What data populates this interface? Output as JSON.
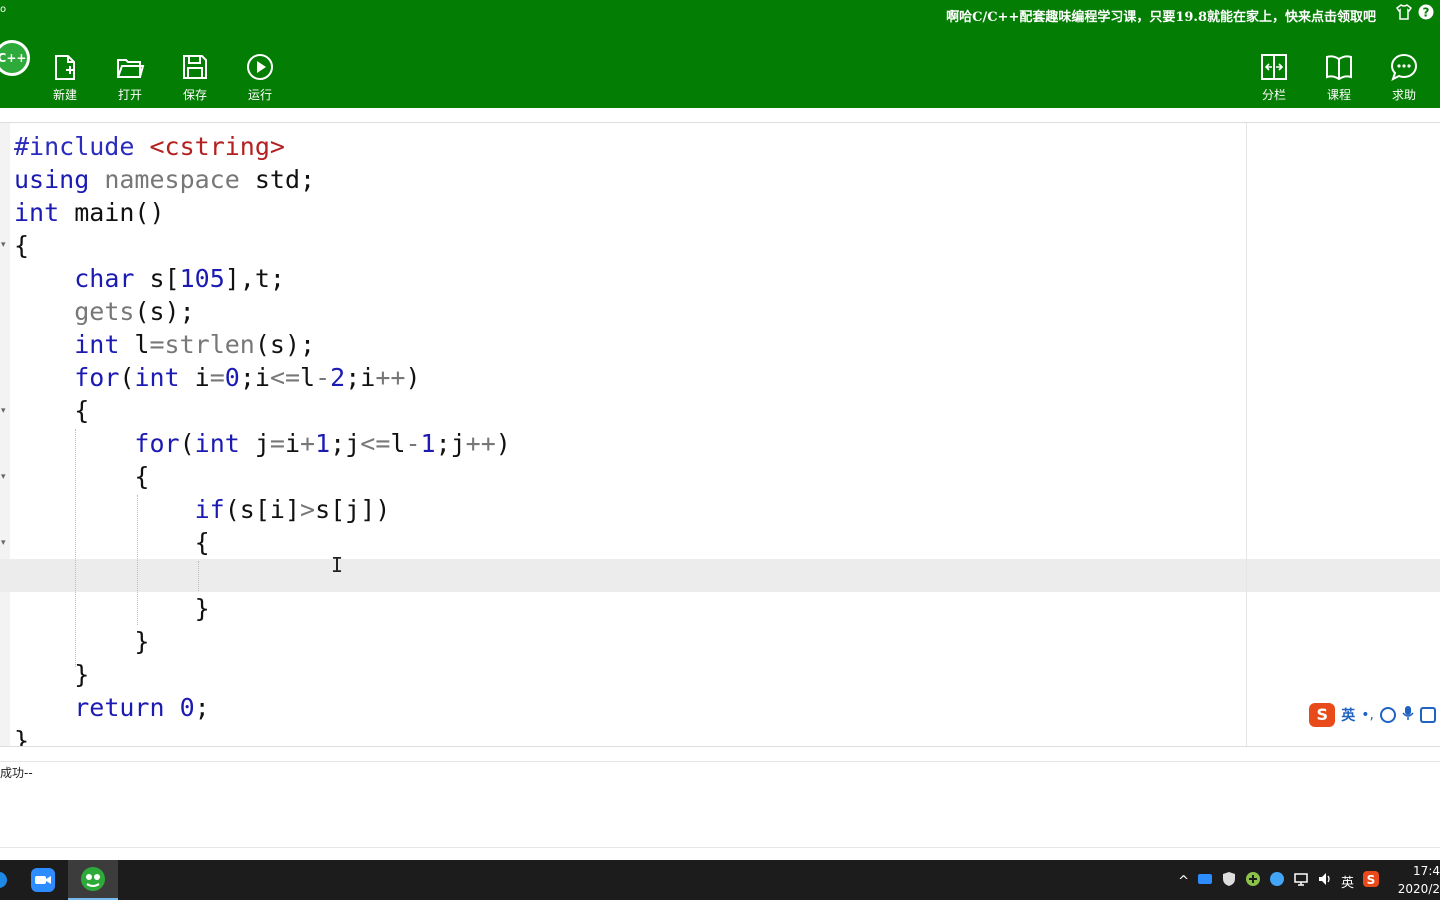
{
  "window": {
    "title_fragment": "o",
    "promo_text": "啊哈C/C++配套趣味编程学习课，只要19.8就能在家上，快来点击领取吧"
  },
  "logo_text": "C++",
  "toolbar": {
    "new_label": "新建",
    "open_label": "打开",
    "save_label": "保存",
    "run_label": "运行",
    "split_label": "分栏",
    "course_label": "课程",
    "help_label": "求助"
  },
  "editor": {
    "lines": [
      "#include <cstring>",
      "using namespace std;",
      "int main()",
      "{",
      "    char s[105],t;",
      "    gets(s);",
      "    int l=strlen(s);",
      "    for(int i=0;i<=l-2;i++)",
      "    {",
      "        for(int j=i+1;j<=l-1;j++)",
      "        {",
      "            if(s[i]>s[j])",
      "            {",
      "",
      "            }",
      "        }",
      "    }",
      "    return 0;",
      "}"
    ]
  },
  "ime": {
    "logo": "S",
    "lang": "英",
    "punct": "•,"
  },
  "output": {
    "message": "成功--"
  },
  "taskbar": {
    "tray_lang": "英",
    "tray_caret": "^",
    "clock_time": "17:4",
    "clock_date": "2020/2"
  },
  "colors": {
    "titlebar": "#047d04",
    "keyword": "#1b1bb4",
    "string": "#b32020",
    "taskbar": "#1c1c1c"
  }
}
